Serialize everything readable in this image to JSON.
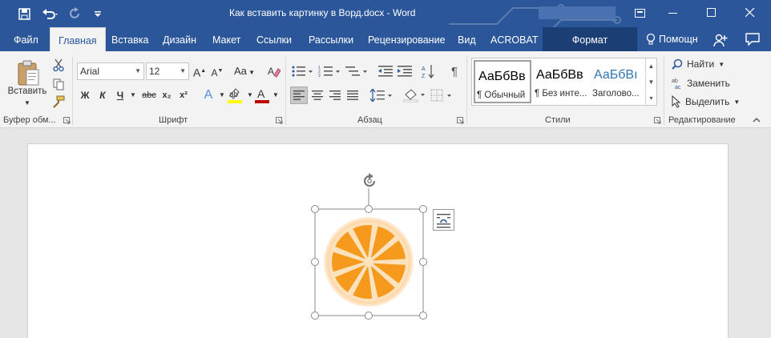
{
  "window": {
    "title": "Как вставить картинку в Ворд.docx - Word",
    "qat": {
      "save_icon": "save-icon",
      "undo_icon": "undo-icon",
      "redo_icon": "redo-icon",
      "customize_icon": "customize-qat-icon"
    },
    "controls": [
      "ribbon-display-options-icon",
      "minimize-icon",
      "maximize-icon",
      "close-icon"
    ]
  },
  "tabs": {
    "file": "Файл",
    "home": "Главная",
    "insert": "Вставка",
    "design": "Дизайн",
    "layout": "Макет",
    "references": "Ссылки",
    "mailings": "Рассылки",
    "review": "Рецензирование",
    "view": "Вид",
    "acrobat": "ACROBAT",
    "format": "Формат",
    "tell_me": "Помощн",
    "share_icon": "share-icon",
    "comments_icon": "comments-icon"
  },
  "ribbon": {
    "clipboard": {
      "label": "Буфер обм...",
      "paste": "Вставить"
    },
    "font": {
      "label": "Шрифт",
      "font_name": "Arial",
      "font_size": "12",
      "case_label": "Aa",
      "bold": "Ж",
      "italic": "К",
      "underline": "Ч",
      "strike": "abc",
      "subscript": "x₂",
      "superscript": "x²",
      "grow": "A",
      "shrink": "A",
      "effects": "A",
      "highlight_color": "#ffff00",
      "font_color_value": "#c00000",
      "font_color": "A"
    },
    "paragraph": {
      "label": "Абзац"
    },
    "styles": {
      "label": "Стили",
      "items": [
        {
          "sample": "АаБбВв",
          "name": "¶ Обычный",
          "color": "#000000"
        },
        {
          "sample": "АаБбВв",
          "name": "¶ Без инте...",
          "color": "#000000"
        },
        {
          "sample": "АаБбВı",
          "name": "Заголово...",
          "color": "#2e74b5"
        }
      ]
    },
    "editing": {
      "label": "Редактирование",
      "find": "Найти",
      "replace": "Заменить",
      "select": "Выделить"
    }
  },
  "document": {
    "image_name": "orange-slice-icon",
    "accent_orange": "#f59a1c",
    "rind": "#ffc98a"
  }
}
